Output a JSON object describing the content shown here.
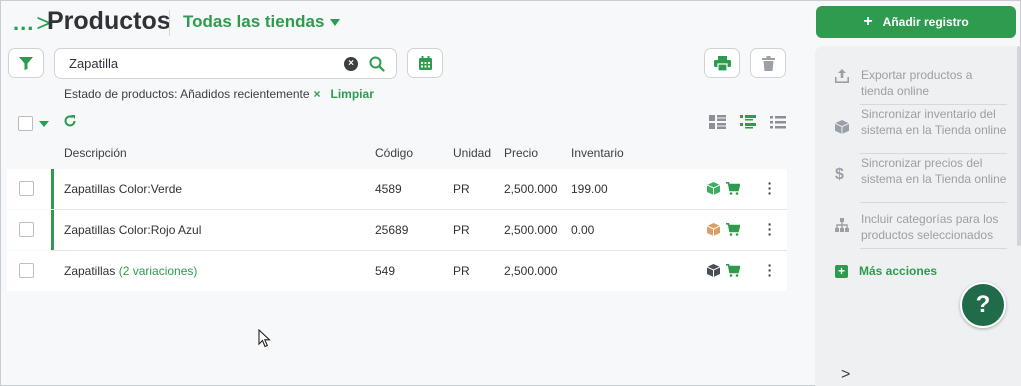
{
  "header": {
    "breadcrumb": "...",
    "title": "Productos",
    "store_selector": "Todas las tiendas",
    "add_button": "Añadir registro"
  },
  "search": {
    "value": "Zapatilla",
    "placeholder": ""
  },
  "filter": {
    "label": "Estado de productos: Añadidos recientemente",
    "remove": "×",
    "clear": "Limpiar"
  },
  "table": {
    "columns": [
      "Descripción",
      "Código",
      "Unidad",
      "Precio",
      "Inventario"
    ],
    "rows": [
      {
        "description": "Zapatillas Color:Verde",
        "variations": "",
        "code": "4589",
        "unit": "PR",
        "price": "2,500.000",
        "inventory": "199.00",
        "box_color": "#3fae62"
      },
      {
        "description": "Zapatillas Color:Rojo Azul",
        "variations": "",
        "code": "25689",
        "unit": "PR",
        "price": "2,500.000",
        "inventory": "0.00",
        "box_color": "#d9a066"
      },
      {
        "description": "Zapatillas",
        "variations": "(2 variaciones)",
        "code": "549",
        "unit": "PR",
        "price": "2,500.000",
        "inventory": "",
        "box_color": "#4a4f55"
      }
    ]
  },
  "side_panel": {
    "items": [
      {
        "label": "Exportar productos a tienda online",
        "icon": "upload-icon"
      },
      {
        "label": "Sincronizar inventario del sistema en la Tienda online",
        "icon": "box-icon"
      },
      {
        "label": "Sincronizar precios del sistema en la Tienda online",
        "icon": "dollar-icon"
      },
      {
        "label": "Incluir categorías para los productos seleccionados",
        "icon": "hierarchy-icon"
      }
    ],
    "more_actions": "Más acciones",
    "help": "?"
  },
  "colors": {
    "accent": "#2e9b4f",
    "help_bg": "#1f6b4a"
  }
}
